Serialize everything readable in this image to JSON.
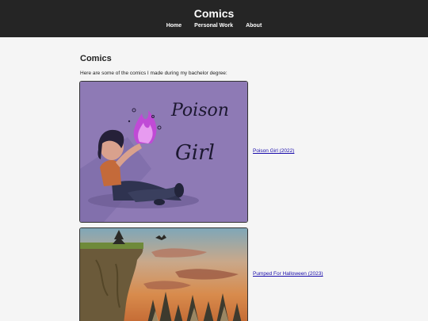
{
  "header": {
    "title": "Comics",
    "nav": [
      "Home",
      "Personal Work",
      "About"
    ]
  },
  "main": {
    "heading": "Comics",
    "intro": "Here are some of the comics I made during my bachelor degree:",
    "comics": [
      {
        "link_text": "Poison Girl (2022)",
        "image_text": [
          "Poison",
          "Girl"
        ]
      },
      {
        "link_text": "Pumped For Halloween (2023)"
      }
    ]
  },
  "colors": {
    "header_bg": "#252525",
    "page_bg": "#f5f5f5",
    "link": "#1a0dab",
    "poison_bg": "#8e7ab5",
    "flame": "#c04ad6"
  }
}
